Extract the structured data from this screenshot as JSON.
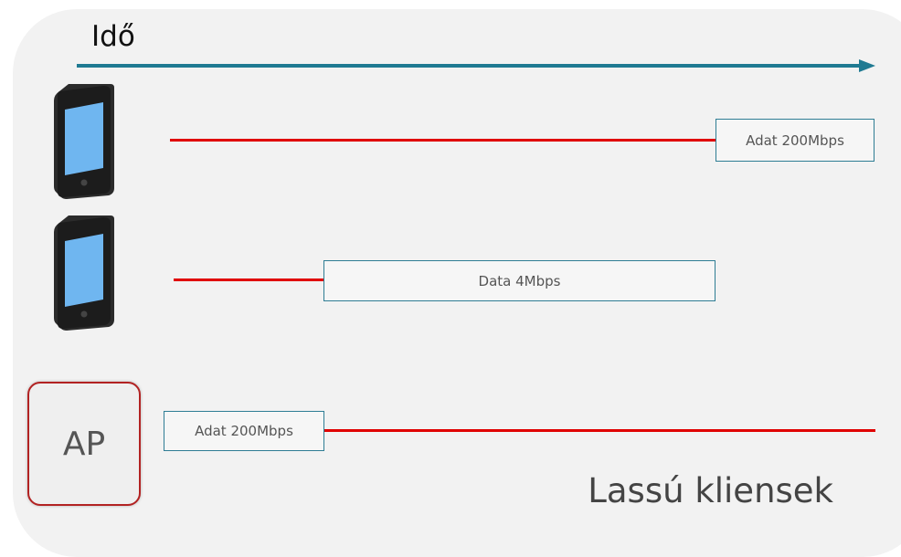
{
  "axis": {
    "label": "Idő"
  },
  "rows": [
    {
      "device": "tablet",
      "label": "Adat 200Mbps"
    },
    {
      "device": "tablet",
      "label": "Data 4Mbps"
    },
    {
      "device": "ap",
      "device_label": "AP",
      "label": "Adat 200Mbps"
    }
  ],
  "caption": "Lassú kliensek",
  "colors": {
    "axis": "#1f7a92",
    "transmission_line": "#e00000",
    "box_border": "#2e7d94",
    "ap_border": "#b22222",
    "tablet_screen": "#6fb6f0",
    "tablet_body": "#1c1c1c"
  }
}
